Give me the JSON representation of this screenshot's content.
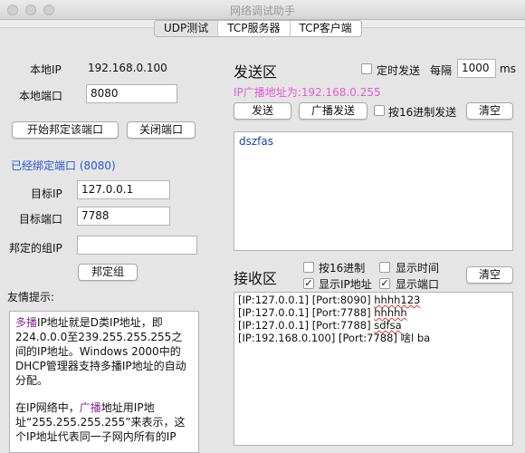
{
  "window": {
    "title": "网络调试助手"
  },
  "tabs": [
    "UDP测试",
    "TCP服务器",
    "TCP客户端"
  ],
  "left": {
    "local_ip_label": "本地IP",
    "local_ip_value": "192.168.0.100",
    "local_port_label": "本地端口",
    "local_port_value": "8080",
    "bind_port_button": "开始邦定该端口",
    "close_port_button": "关闭端口",
    "bound_status": "已经绑定端口 (8080)",
    "target_ip_label": "目标IP",
    "target_ip_value": "127.0.0.1",
    "target_port_label": "目标端口",
    "target_port_value": "7788",
    "group_ip_label": "邦定的组IP",
    "group_ip_value": "",
    "bind_group_button": "邦定组",
    "tips_label": "友情提示:",
    "tips": {
      "p1_kw": "多播",
      "p1_rest": "IP地址就是D类IP地址，即224.0.0.0至239.255.255.255之间的IP地址。Windows 2000中的DHCP管理器支持多播IP地址的自动分配。",
      "p2_pre": "在IP网络中，",
      "p2_kw": "广播",
      "p2_rest": "地址用IP地址“255.255.255.255”来表示，这个IP地址代表同一子网内所有的IP"
    }
  },
  "send": {
    "title": "发送区",
    "timed_send_label": "定时发送",
    "timed_send_checked": false,
    "interval_label": "每隔",
    "interval_value": "1000",
    "interval_unit": "ms",
    "broadcast_info": "IP广播地址为:192.168.0.255",
    "send_button": "发送",
    "broadcast_send_button": "广播发送",
    "hex_send_label": "按16进制发送",
    "hex_send_checked": false,
    "clear_button": "清空",
    "content": "dszfas"
  },
  "receive": {
    "title": "接收区",
    "hex_label": "按16进制",
    "hex_checked": false,
    "show_time_label": "显示时间",
    "show_time_checked": false,
    "show_ip_label": "显示IP地址",
    "show_ip_checked": true,
    "show_port_label": "显示端口",
    "show_port_checked": true,
    "clear_button": "清空",
    "lines": [
      {
        "prefix": "[IP:127.0.0.1] [Port:8090] ",
        "msg": "hhhh123"
      },
      {
        "prefix": "[IP:127.0.0.1] [Port:7788] ",
        "msg": "hhhhh"
      },
      {
        "prefix": "[IP:127.0.0.1] [Port:7788] ",
        "msg": "sdfsa"
      },
      {
        "prefix": "[IP:192.168.0.100] [Port:7788] ",
        "msg": "啥l ba"
      }
    ]
  }
}
